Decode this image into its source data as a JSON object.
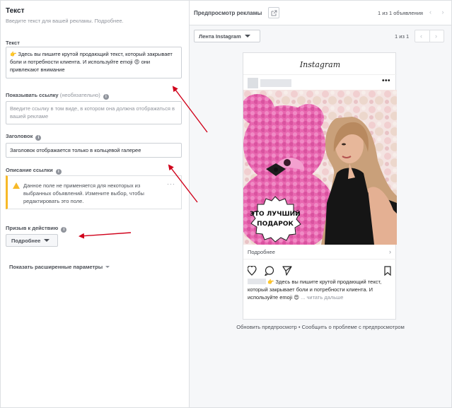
{
  "left": {
    "section_title": "Текст",
    "section_subtitle": "Введите текст для вашей рекламы. Подробнее.",
    "text_label": "Текст",
    "text_emoji": "👉",
    "text_value": "Здесь вы пишите крутой продающий текст, который закрывает боли и потребности клиента. И используйте emoji",
    "text_emoji2": "😍",
    "text_value_end": "они привлекают внимание",
    "link_label": "Показывать ссылку",
    "link_label_optional": "(необязательно)",
    "link_placeholder": "Введите ссылку в том виде, в котором она должна отображаться в вашей рекламе",
    "headline_label": "Заголовок",
    "headline_value": "Заголовок отображается только в кольцевой галерее",
    "link_desc_label": "Описание ссылки",
    "warning_text": "Данное поле не применяется для некоторых из выбранных объявлений. Измените выбор, чтобы редактировать это поле.",
    "warning_more": "···",
    "cta_label": "Призыв к действию",
    "cta_value": "Подробнее",
    "advanced_label": "Показать расширенные параметры"
  },
  "right": {
    "title": "Предпросмотр рекламы",
    "ad_count": "1 из 1 объявления",
    "nav_arrows": "‹ ›",
    "feed_label": "Лента Instagram",
    "page_count": "1 из 1",
    "prev_arrow": "‹",
    "next_arrow": "›",
    "phone": {
      "logo": "Instagram",
      "menu_dots": "•••",
      "badge_line1": "ЭТО ЛУЧШИЙ",
      "badge_line2": "ПОДАРОК",
      "more_label": "Подробнее",
      "more_chevron": "›",
      "caption_emoji": "👉",
      "caption": "Здесь вы пишите крутой продающий текст, который закрывает боли и потребности клиента. И используйте emoji",
      "caption_emoji2": "😍",
      "read_more": "... читать дальше"
    },
    "footer": "Обновить предпросмотр • Сообщить о проблеме с предпросмотром"
  },
  "colors": {
    "border": "#dddfe2",
    "warning": "#f7b928",
    "arrow": "#d0021b",
    "text_muted": "#90949c"
  }
}
